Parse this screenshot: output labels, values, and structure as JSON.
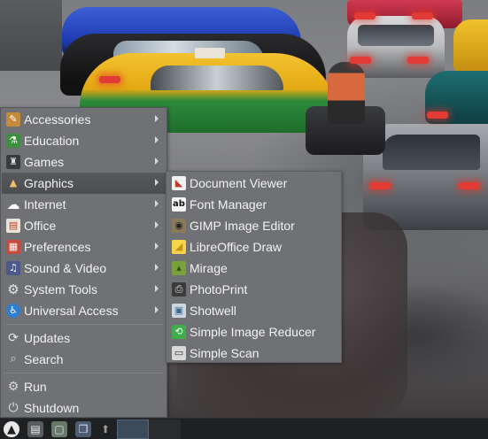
{
  "main_menu": {
    "items": [
      {
        "label": "Accessories",
        "icon": "accessories-icon",
        "submenu": true
      },
      {
        "label": "Education",
        "icon": "education-icon",
        "submenu": true
      },
      {
        "label": "Games",
        "icon": "games-icon",
        "submenu": true
      },
      {
        "label": "Graphics",
        "icon": "graphics-icon",
        "submenu": true,
        "highlighted": true
      },
      {
        "label": "Internet",
        "icon": "internet-icon",
        "submenu": true
      },
      {
        "label": "Office",
        "icon": "office-icon",
        "submenu": true
      },
      {
        "label": "Preferences",
        "icon": "preferences-icon",
        "submenu": true
      },
      {
        "label": "Sound & Video",
        "icon": "sound-video-icon",
        "submenu": true
      },
      {
        "label": "System Tools",
        "icon": "system-tools-icon",
        "submenu": true
      },
      {
        "label": "Universal Access",
        "icon": "universal-access-icon",
        "submenu": true
      }
    ],
    "actions": [
      {
        "label": "Updates",
        "icon": "updates-icon"
      },
      {
        "label": "Search",
        "icon": "search-icon"
      }
    ],
    "session": [
      {
        "label": "Run",
        "icon": "run-icon"
      },
      {
        "label": "Shutdown",
        "icon": "shutdown-icon"
      }
    ]
  },
  "graphics_submenu": {
    "items": [
      {
        "label": "Document Viewer",
        "icon": "document-viewer-icon"
      },
      {
        "label": "Font Manager",
        "icon": "font-manager-icon"
      },
      {
        "label": "GIMP Image Editor",
        "icon": "gimp-icon"
      },
      {
        "label": "LibreOffice Draw",
        "icon": "libreoffice-draw-icon"
      },
      {
        "label": "Mirage",
        "icon": "mirage-icon"
      },
      {
        "label": "PhotoPrint",
        "icon": "photoprint-icon"
      },
      {
        "label": "Shotwell",
        "icon": "shotwell-icon"
      },
      {
        "label": "Simple Image Reducer",
        "icon": "simple-image-reducer-icon"
      },
      {
        "label": "Simple Scan",
        "icon": "simple-scan-icon"
      }
    ]
  },
  "panel": {
    "launchers": [
      "start-menu-icon",
      "file-manager-icon",
      "desktop-switch-icon",
      "windows-icon",
      "pin-icon"
    ]
  },
  "colors": {
    "menu_bg": "#6f7174",
    "menu_highlight": "#4f5155",
    "panel_bg": "#1f2022",
    "text": "#f2f2f2"
  }
}
